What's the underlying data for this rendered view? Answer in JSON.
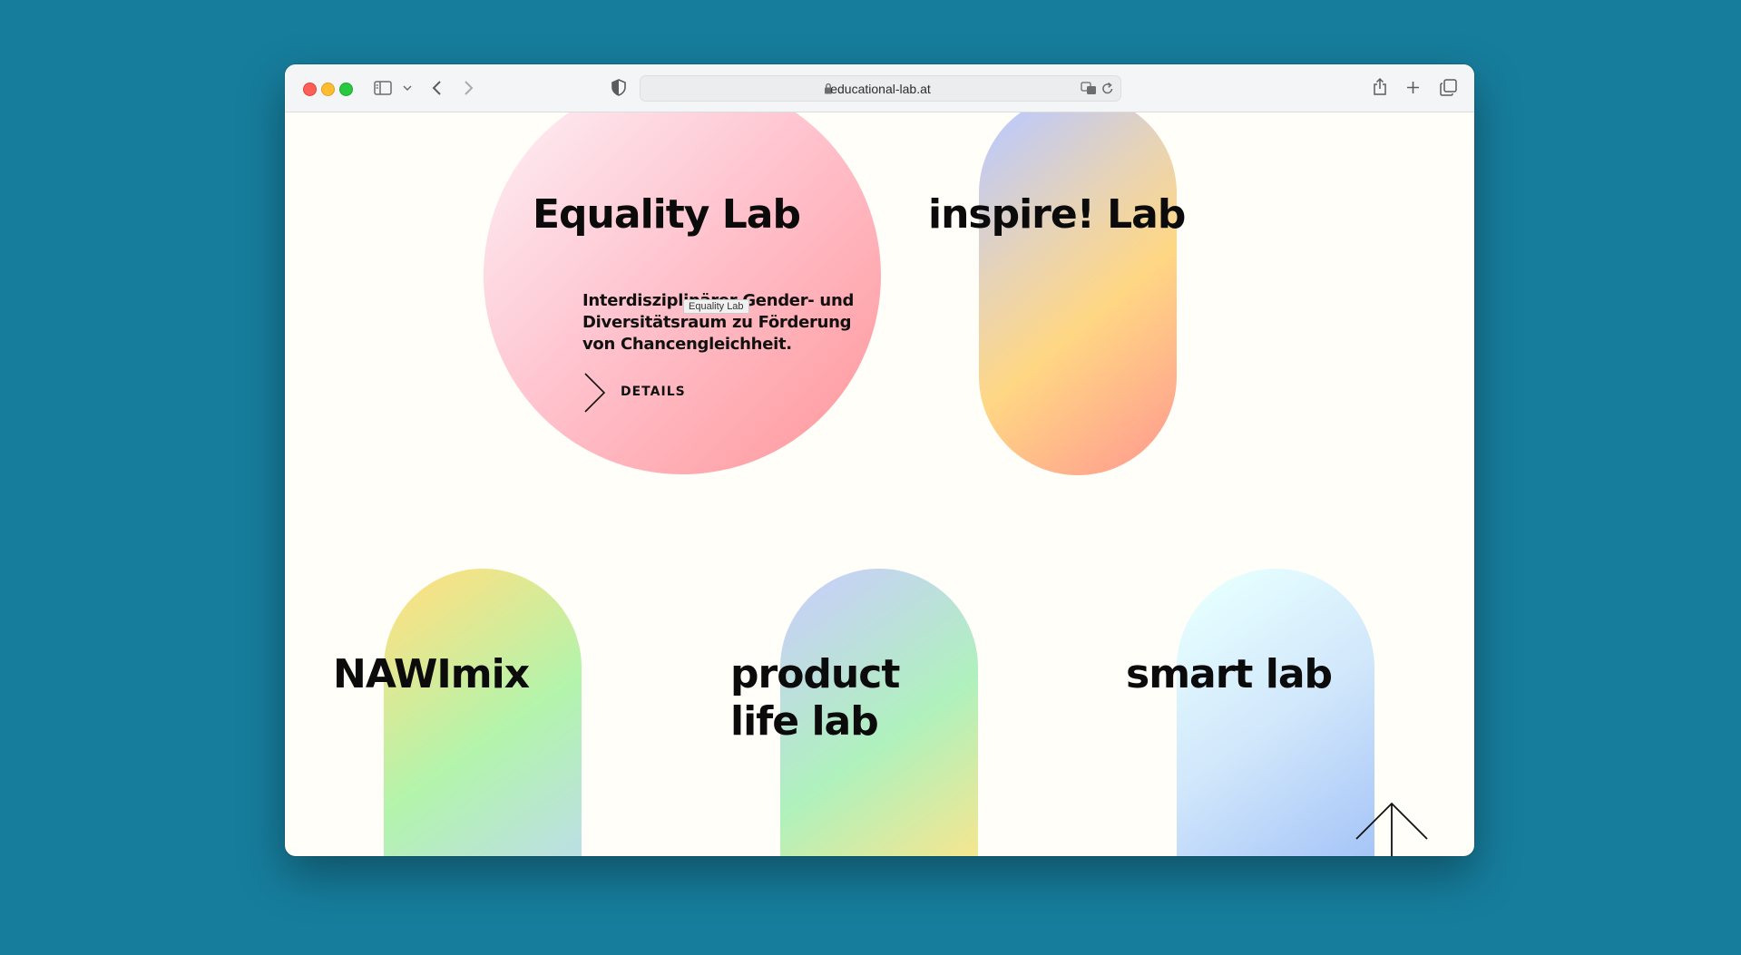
{
  "browser": {
    "url": "educational-lab.at",
    "icons": [
      "sidebar-icon",
      "chevron-down-icon",
      "back-icon",
      "forward-icon",
      "shield-icon",
      "lock-icon",
      "translate-icon",
      "reload-icon",
      "share-icon",
      "new-tab-icon",
      "tabs-overview-icon"
    ]
  },
  "labs": [
    {
      "title": "Equality Lab",
      "description": "Interdisziplinärer Gender- und Diversitätsraum zu Förderung von Chancengleichheit.",
      "details_label": "DETAILS",
      "tooltip": "Equality Lab"
    },
    {
      "title": "inspire! Lab"
    },
    {
      "title": "NAWImix"
    },
    {
      "title": "product life lab"
    },
    {
      "title": "smart lab"
    }
  ],
  "scroll_top_icon": "arrow-up-icon"
}
